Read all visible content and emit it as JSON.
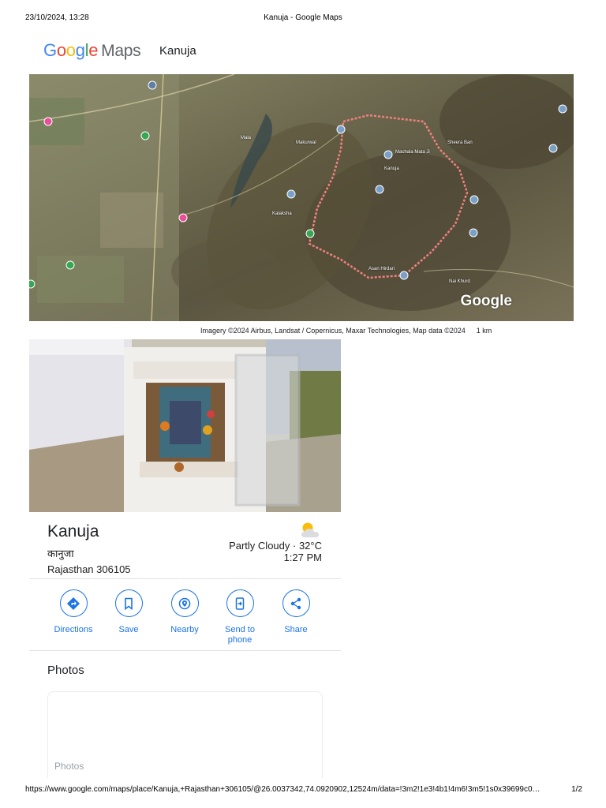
{
  "print_header": {
    "datetime": "23/10/2024, 13:28",
    "page_title": "Kanuja - Google Maps"
  },
  "logo": {
    "google": [
      "G",
      "o",
      "o",
      "g",
      "l",
      "e"
    ],
    "maps": "Maps",
    "colors": [
      "#4285F4",
      "#EA4335",
      "#FBBC05",
      "#4285F4",
      "#34A853",
      "#EA4335"
    ]
  },
  "header": {
    "place_name": "Kanuja"
  },
  "map": {
    "watermark": "Google",
    "labels": {
      "kanuja": "Kanuja",
      "machala_mata": "Machala Mata Ji",
      "asan": "Asan Hirdari",
      "nai_khurd": "Nai Khurd",
      "sheera": "Sheera Ban",
      "makurwal": "Makurwal",
      "mala": "Mala",
      "kalaksha": "Kalaksha"
    },
    "boundary_color": "#f08080"
  },
  "attribution": {
    "text": "Imagery ©2024 Airbus, Landsat / Copernicus, Maxar Technologies, Map data ©2024",
    "scale": "1 km"
  },
  "place": {
    "title": "Kanuja",
    "subtitle": "कानुजा",
    "address": "Rajasthan 306105",
    "weather": {
      "condition": "Partly Cloudy · 32°C",
      "time": "1:27 PM"
    }
  },
  "actions": [
    {
      "id": "directions",
      "label": "Directions",
      "icon": "directions-icon"
    },
    {
      "id": "save",
      "label": "Save",
      "icon": "bookmark-icon"
    },
    {
      "id": "nearby",
      "label": "Nearby",
      "icon": "nearby-icon"
    },
    {
      "id": "send",
      "label": "Send to phone",
      "icon": "send-to-phone-icon"
    },
    {
      "id": "share",
      "label": "Share",
      "icon": "share-icon"
    }
  ],
  "photos": {
    "heading": "Photos",
    "card_label": "Photos"
  },
  "print_footer": {
    "url": "https://www.google.com/maps/place/Kanuja,+Rajasthan+306105/@26.0037342,74.0920902,12524m/data=!3m2!1e3!4b1!4m6!3m5!1s0x39699c0…",
    "page": "1/2"
  },
  "colors": {
    "accent": "#1a73e8",
    "text": "#202124",
    "muted": "#5f6368"
  }
}
